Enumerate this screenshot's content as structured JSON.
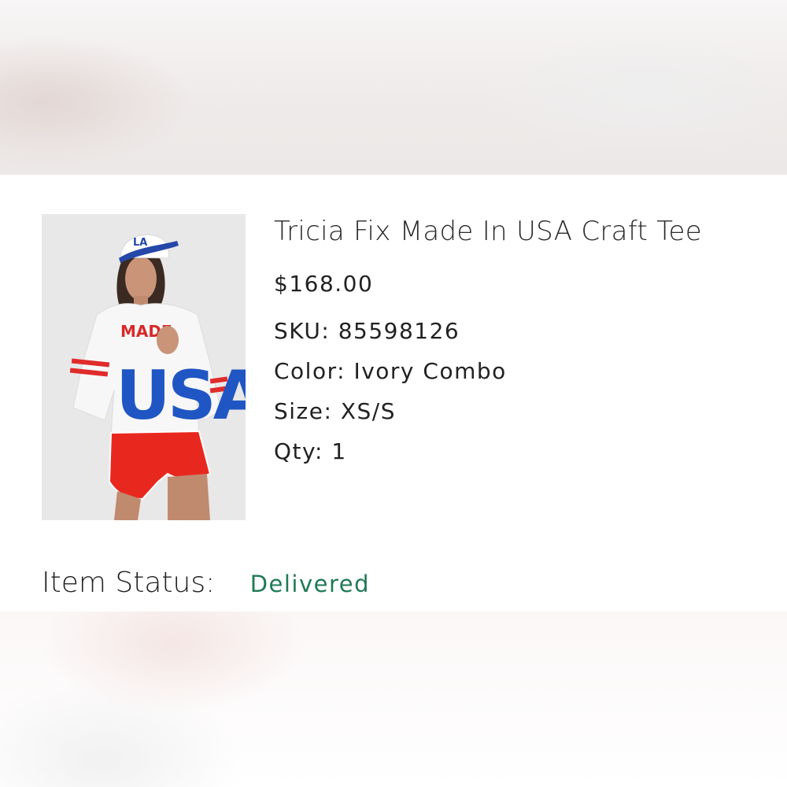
{
  "product": {
    "title": "Tricia Fix Made In USA Craft Tee",
    "price": "$168.00",
    "image_alt": "Model wearing white MADE IN USA tee with red shorts and LA cap",
    "image_print_top": "MADE",
    "image_print_main": "USA",
    "image_cap_text": "LA"
  },
  "details": {
    "sku_label": "SKU:",
    "sku_value": "85598126",
    "color_label": "Color:",
    "color_value": "Ivory Combo",
    "size_label": "Size:",
    "size_value": "XS/S",
    "qty_label": "Qty:",
    "qty_value": "1"
  },
  "status": {
    "label": "Item Status:",
    "value": "Delivered",
    "color": "#1f7a55"
  }
}
